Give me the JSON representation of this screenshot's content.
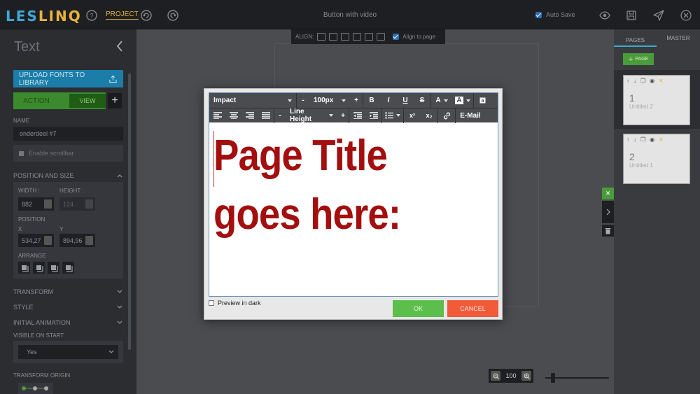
{
  "topbar": {
    "logo_part1": "LES",
    "logo_part2": "LINQ",
    "project_link": "PROJECT",
    "doc_title": "Button with video",
    "autosave_label": "Auto Save",
    "autosave_checked": true
  },
  "left_panel": {
    "title": "Text",
    "upload_label": "UPLOAD FONTS TO LIBRARY",
    "action_label": "ACTION",
    "view_label": "VIEW",
    "name_label": "NAME",
    "name_value": "onderdeel #7",
    "enable_scrollbar": "Enable scrollbar",
    "position_size_label": "POSITION AND SIZE",
    "width_label": "WIDTH :",
    "width_value": "882",
    "height_label": "HEIGHT :",
    "height_value": "124",
    "position_label": "POSITION",
    "x_label": "X",
    "x_value": "534,27",
    "y_label": "Y",
    "y_value": "894,96",
    "arrange_label": "ARRANGE",
    "transform_label": "TRANSFORM",
    "style_label": "STYLE",
    "initial_animation_label": "INITIAL ANIMATION",
    "visible_on_start_label": "VISIBLE ON START",
    "visible_on_start_value": "Yes",
    "transform_origin_label": "TRANSFORM ORIGIN"
  },
  "align_toolbar": {
    "label": "ALIGN:",
    "align_to_page": "Align to page"
  },
  "right_panel": {
    "tab_pages": "PAGES",
    "tab_master": "MASTER",
    "add_page": "PAGE",
    "pages": [
      {
        "number": "1",
        "name": "Untitled 2"
      },
      {
        "number": "2",
        "name": "Untitled 1"
      }
    ]
  },
  "zoom": {
    "value": "100",
    "minus": "-",
    "plus": "+"
  },
  "modal": {
    "font_family": "Impact",
    "font_size": "100px",
    "minus": "-",
    "plus": "+",
    "line_height": "Line Height",
    "email": "E-Mail",
    "bold": "B",
    "italic": "I",
    "underline": "U",
    "strike": "S",
    "font_color": "A",
    "highlight": "A",
    "superscript": "x²",
    "subscript": "x₂",
    "content_line1": "Page Title",
    "content_line2": "goes here:",
    "text_color": "#a30e0e",
    "preview_dark": "Preview in dark",
    "ok": "OK",
    "cancel": "CANCEL"
  }
}
